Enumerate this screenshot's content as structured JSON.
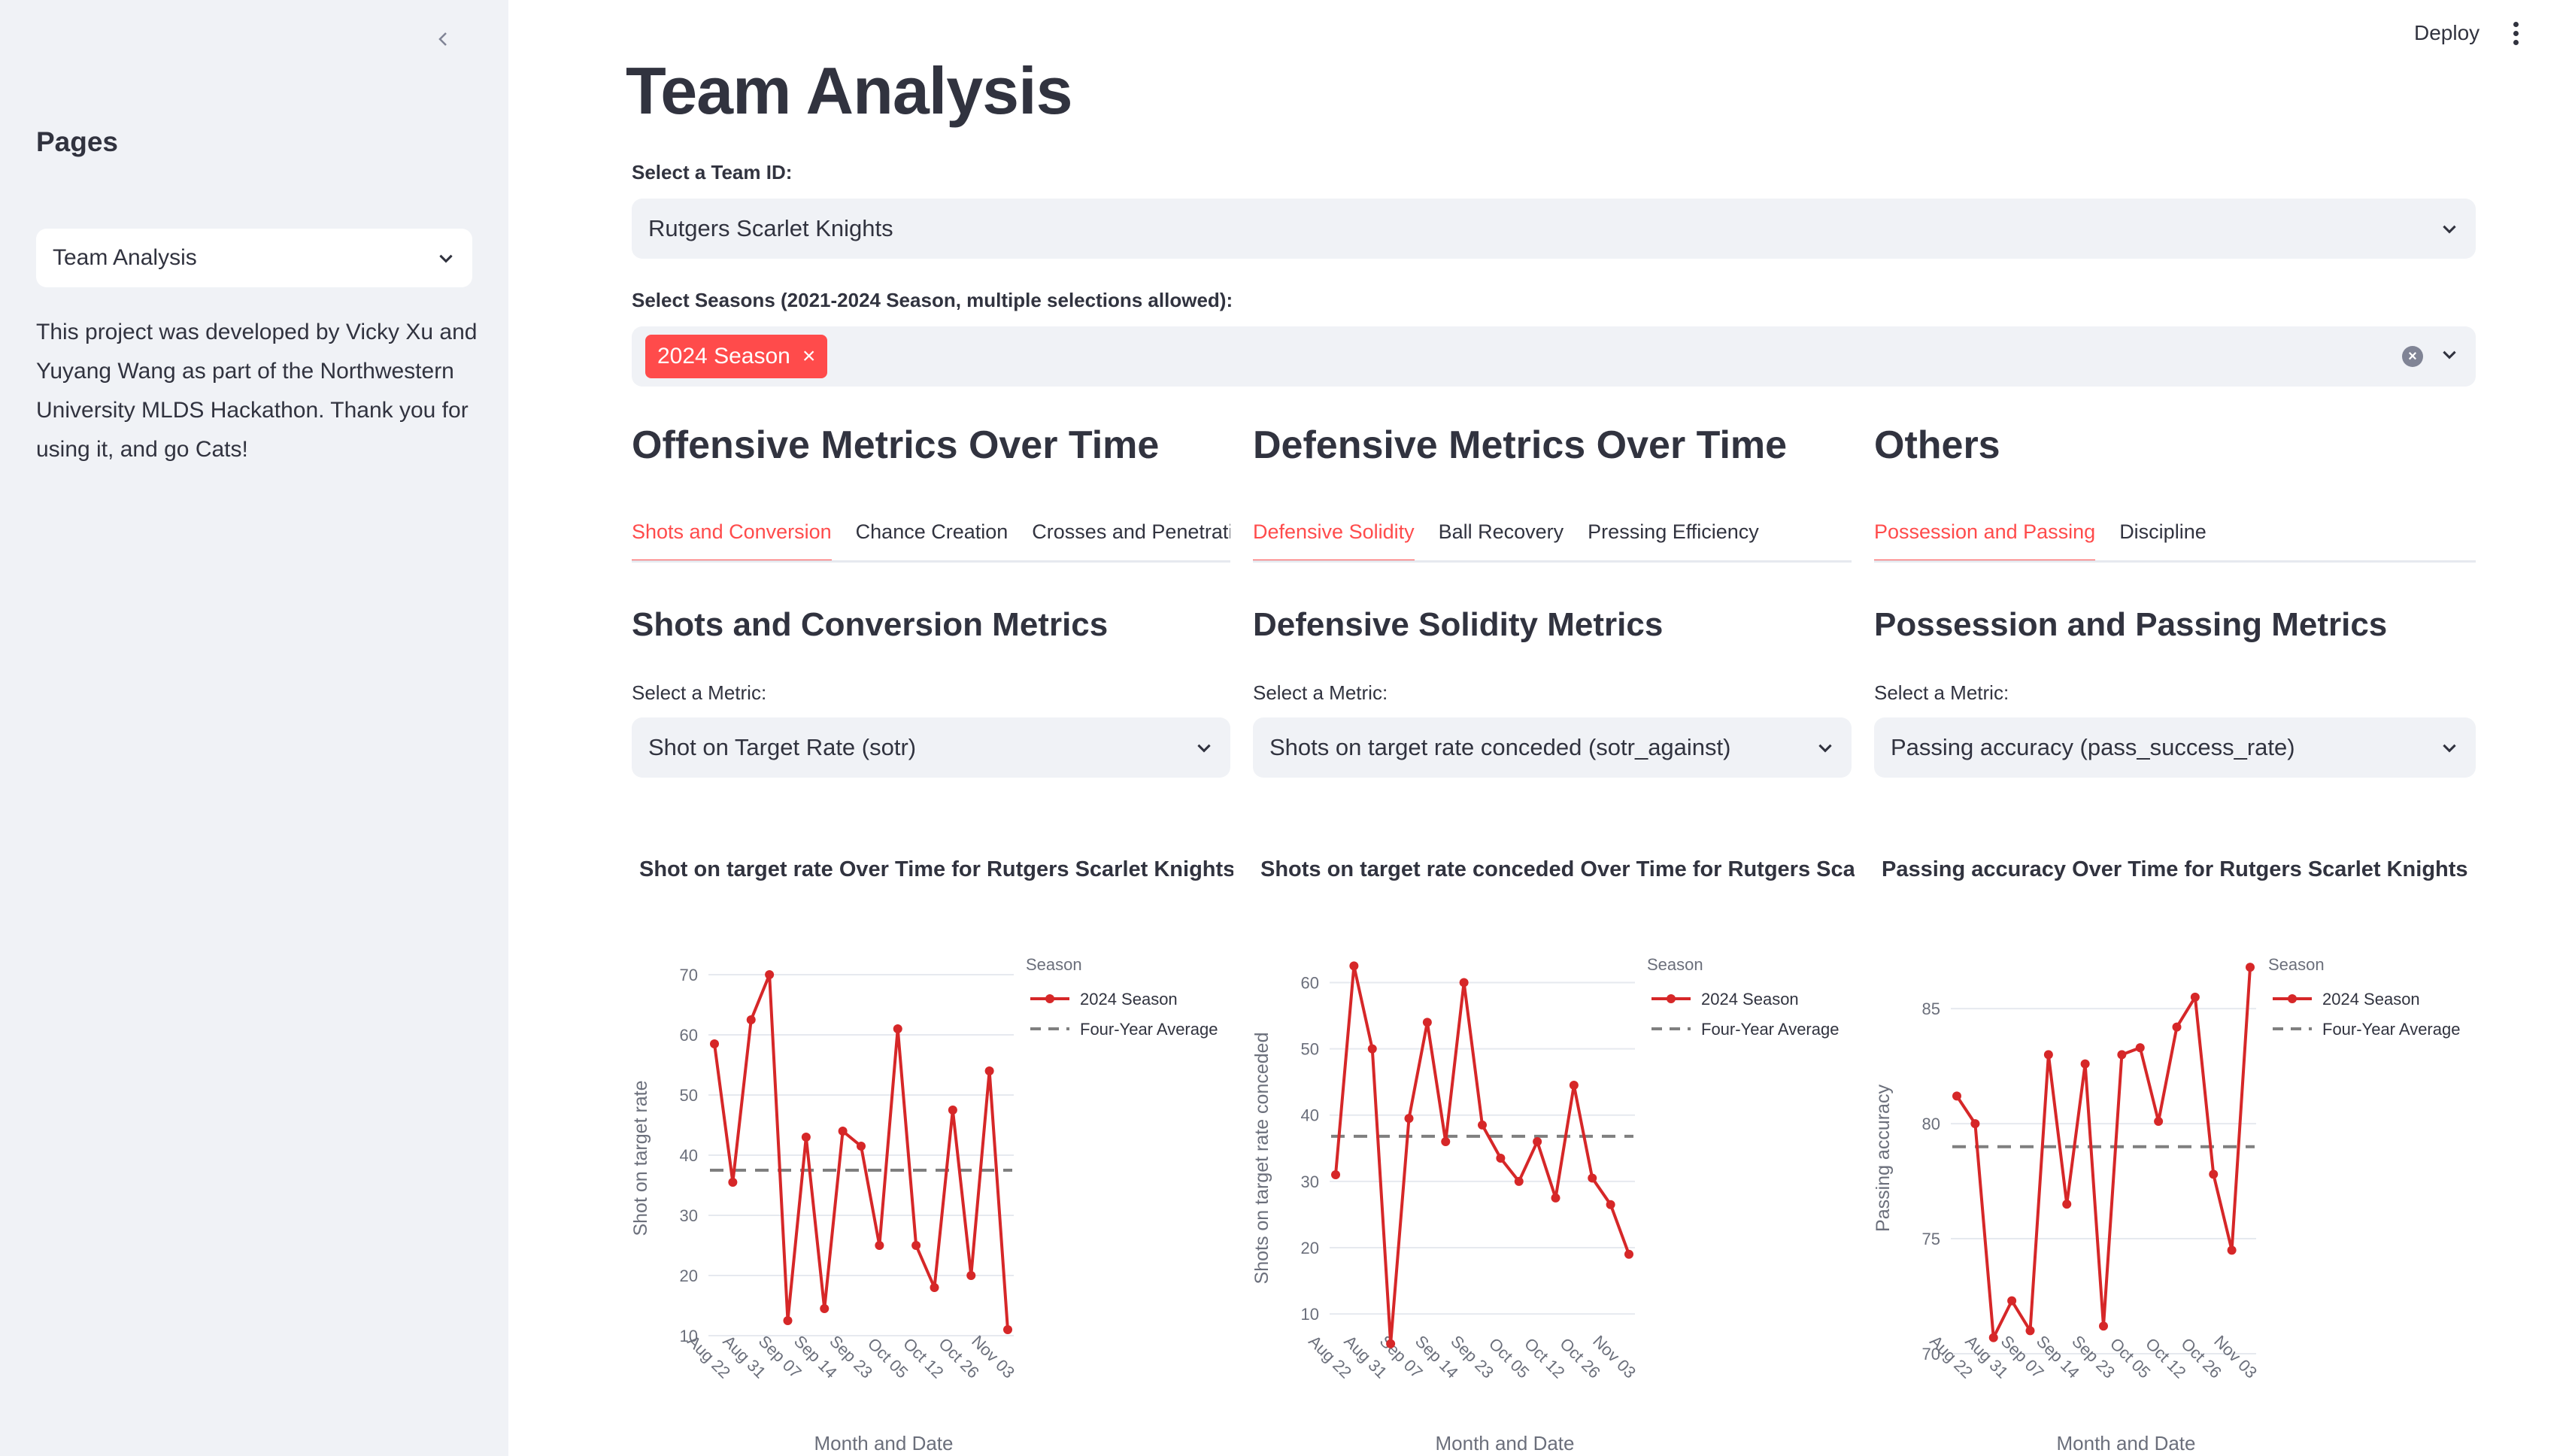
{
  "sidebar": {
    "title": "Pages",
    "page_select": "Team Analysis",
    "description": "This project was developed by Vicky Xu and Yuyang Wang as part of the Northwestern University MLDS Hackathon. Thank you for using it, and go Cats!"
  },
  "topbar": {
    "deploy": "Deploy"
  },
  "main": {
    "title": "Team Analysis",
    "team_label": "Select a Team ID:",
    "team_value": "Rutgers Scarlet Knights",
    "season_label": "Select Seasons (2021-2024 Season, multiple selections allowed):",
    "season_tag": "2024 Season",
    "tag_close": "×",
    "clear_icon": "×"
  },
  "columns": [
    {
      "section_title": "Offensive Metrics Over Time",
      "tabs": [
        "Shots and Conversion",
        "Chance Creation",
        "Crosses and Penetration"
      ],
      "sub_title": "Shots and Conversion Metrics",
      "metric_label": "Select a Metric:",
      "metric_value": "Shot on Target Rate (sotr)"
    },
    {
      "section_title": "Defensive Metrics Over Time",
      "tabs": [
        "Defensive Solidity",
        "Ball Recovery",
        "Pressing Efficiency"
      ],
      "sub_title": "Defensive Solidity Metrics",
      "metric_label": "Select a Metric:",
      "metric_value": "Shots on target rate conceded (sotr_against)"
    },
    {
      "section_title": "Others",
      "tabs": [
        "Possession and Passing",
        "Discipline"
      ],
      "sub_title": "Possession and Passing Metrics",
      "metric_label": "Select a Metric:",
      "metric_value": "Passing accuracy (pass_success_rate)"
    }
  ],
  "colors": {
    "accent": "#ff4b4b",
    "series": "#d62728",
    "average": "#7f7f7f"
  },
  "chart_data": [
    {
      "type": "line",
      "title": "Shot on target rate Over Time for  Rutgers Scarlet Knights",
      "xlabel": "Month and Date",
      "ylabel": "Shot on target rate",
      "tick_labels": [
        "Aug 22",
        "Aug 31",
        "Sep 07",
        "Sep 14",
        "Sep 23",
        "Oct 05",
        "Oct 12",
        "Oct 26",
        "Nov 03"
      ],
      "ylim": [
        7,
        72
      ],
      "yticks": [
        10,
        20,
        30,
        40,
        50,
        60,
        70
      ],
      "legend_title": "Season",
      "legend_placement": "top-right",
      "series": [
        {
          "name": "2024 Season",
          "values": [
            58.5,
            35.5,
            62.5,
            70,
            12.5,
            43,
            14.5,
            44,
            41.5,
            25,
            61,
            25,
            18,
            47.5,
            20,
            54,
            11
          ]
        }
      ],
      "average": {
        "name": "Four-Year Average",
        "value": 37.5
      }
    },
    {
      "type": "line",
      "title": "Shots on target rate conceded Over Time for  Rutgers Scarlet Knights",
      "xlabel": "Month and Date",
      "ylabel": "Shots on target rate conceded",
      "tick_labels": [
        "Aug 22",
        "Aug 31",
        "Sep 07",
        "Sep 14",
        "Sep 23",
        "Oct 05",
        "Oct 12",
        "Oct 26",
        "Nov 03"
      ],
      "ylim": [
        4,
        63
      ],
      "yticks": [
        10,
        20,
        30,
        40,
        50,
        60
      ],
      "legend_title": "Season",
      "legend_placement": "top-right",
      "series": [
        {
          "name": "2024 Season",
          "values": [
            31,
            62.5,
            50,
            5.5,
            39.5,
            54,
            36,
            60,
            38.5,
            33.5,
            30,
            36,
            27.5,
            44.5,
            30.5,
            26.5,
            19
          ]
        }
      ],
      "average": {
        "name": "Four-Year Average",
        "value": 36.8
      }
    },
    {
      "type": "line",
      "title": "Passing accuracy Over Time for  Rutgers Scarlet Knights",
      "xlabel": "Month and Date",
      "ylabel": "Passing accuracy",
      "tick_labels": [
        "Aug 22",
        "Aug 31",
        "Sep 07",
        "Sep 14",
        "Sep 23",
        "Oct 05",
        "Oct 12",
        "Oct 26",
        "Nov 03"
      ],
      "ylim": [
        70,
        87
      ],
      "yticks": [
        70,
        75,
        80,
        85
      ],
      "legend_title": "Season",
      "legend_placement": "top-right",
      "series": [
        {
          "name": "2024 Season",
          "values": [
            81.2,
            80,
            70.7,
            72.3,
            71,
            83,
            76.5,
            82.6,
            71.2,
            83,
            83.3,
            80.1,
            84.2,
            85.5,
            77.8,
            74.5,
            86.8
          ]
        }
      ],
      "average": {
        "name": "Four-Year Average",
        "value": 79
      }
    }
  ]
}
